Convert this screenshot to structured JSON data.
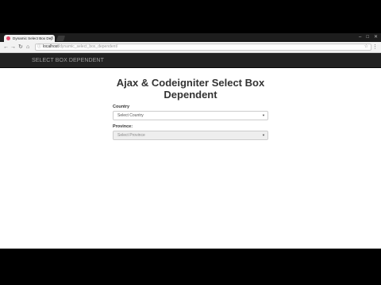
{
  "browser": {
    "tab_title": "Dynamic Select Box Dep",
    "tab_close": "×",
    "window_controls": [
      "–",
      "□",
      "✕"
    ],
    "url_host": "localhost",
    "url_path": "/dynamic_select_box_dependent/",
    "icons": {
      "back": "←",
      "forward": "→",
      "reload": "↻",
      "home": "⌂",
      "page_info": "ⓘ",
      "bookmark_star": "☆",
      "menu": "⋮"
    }
  },
  "navbar": {
    "brand": "SELECT BOX DEPENDENT"
  },
  "page": {
    "title_line1": "Ajax & Codeigniter Select Box",
    "title_line2": "Dependent",
    "country_label": "Country",
    "country_select": "Select Country",
    "province_label": "Province:",
    "province_select": "Select Province",
    "caret": "▼"
  }
}
